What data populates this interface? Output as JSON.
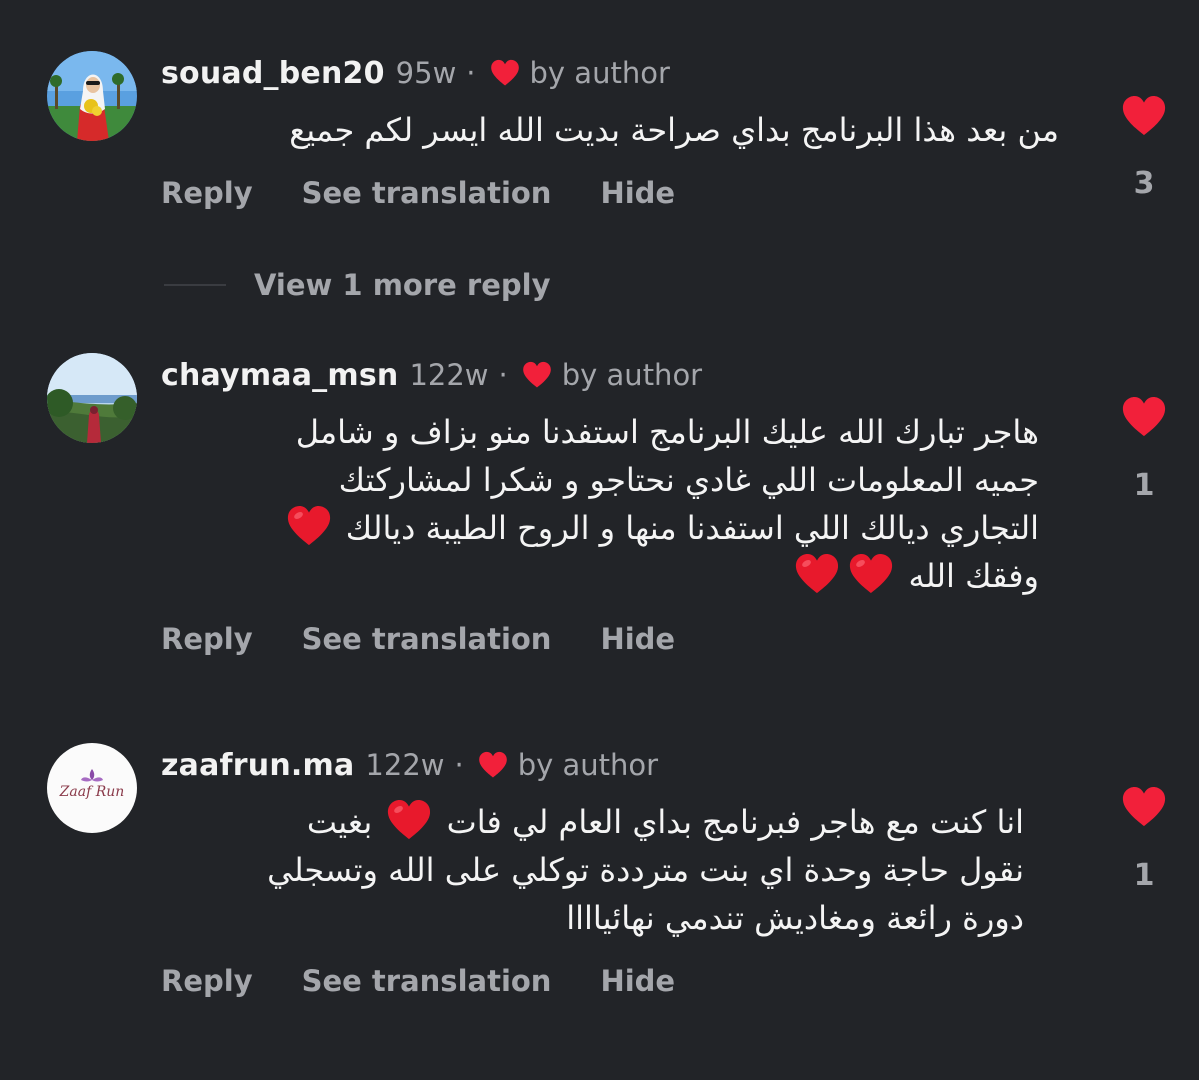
{
  "colors": {
    "background": "#222428",
    "text_primary": "#f2f2f2",
    "text_secondary": "#a4a6ab",
    "heart_red": "#f2203a"
  },
  "icons": {
    "author_like": "heart-icon",
    "like_button": "heart-icon",
    "emoji": "red-heart-emoji"
  },
  "actions": {
    "reply": "Reply",
    "see_translation": "See translation",
    "hide": "Hide"
  },
  "comments": [
    {
      "username": "souad_ben20",
      "age": "95w",
      "separator": "·",
      "liked_by": "by author",
      "text": "من بعد هذا البرنامج بداي صراحة بديت الله ايسر لكم جميع",
      "likes": "3",
      "view_replies": "View 1 more reply"
    },
    {
      "username": "chaymaa_msn",
      "age": "122w",
      "separator": "·",
      "liked_by": "by author",
      "text_line1": "هاجر تبارك الله عليك البرنامج استفدنا منو بزاف و شامل",
      "text_line2": "جميه المعلومات اللي غادي نحتاجو و شكرا لمشاركتك",
      "text_line3": "التجاري ديالك اللي استفدنا منها  و الروح الطيبة ديالك",
      "text_line4": "وفقك الله",
      "likes": "1"
    },
    {
      "username": "zaafrun.ma",
      "avatar_logo": "Zaaf Run",
      "age": "122w",
      "separator": "·",
      "liked_by": "by author",
      "text_line1a": "انا كنت مع هاجر فبرنامج بداي العام لي فات",
      "text_line1b": "بغيت",
      "text_line2": "نقول حاجة وحدة اي بنت مترددة  توكلي على الله وتسجلي",
      "text_line3": "دورة رائعة ومغاديش تندمي نهائياااا",
      "likes": "1"
    }
  ]
}
